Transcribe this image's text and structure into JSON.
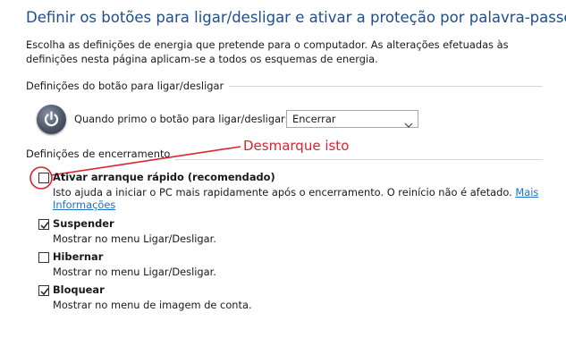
{
  "page": {
    "title": "Definir os botões para ligar/desligar e ativar a proteção por palavra-passe",
    "description": "Escolha as definições de energia que pretende para o computador. As alterações efetuadas às definições nesta página aplicam-se a todos os esquemas de energia."
  },
  "power_button_group": {
    "heading": "Definições do botão para ligar/desligar",
    "label": "Quando primo o botão para ligar/desligar:",
    "selected": "Encerrar",
    "icon": "power-button-icon"
  },
  "shutdown_group": {
    "heading": "Definições de encerramento",
    "options": [
      {
        "label": "Ativar arranque rápido (recomendado)",
        "checked": false,
        "description": "Isto ajuda a iniciar o PC mais rapidamente após o encerramento. O reinício não é afetado.",
        "link_line1": "Mais",
        "link_line2": "Informações"
      },
      {
        "label": "Suspender",
        "checked": true,
        "description": "Mostrar no menu Ligar/Desligar."
      },
      {
        "label": "Hibernar",
        "checked": false,
        "description": "Mostrar no menu Ligar/Desligar."
      },
      {
        "label": "Bloquear",
        "checked": true,
        "description": "Mostrar no menu de imagem de conta."
      }
    ]
  },
  "annotation": {
    "text": "Desmarque isto",
    "color": "#e0202e"
  }
}
